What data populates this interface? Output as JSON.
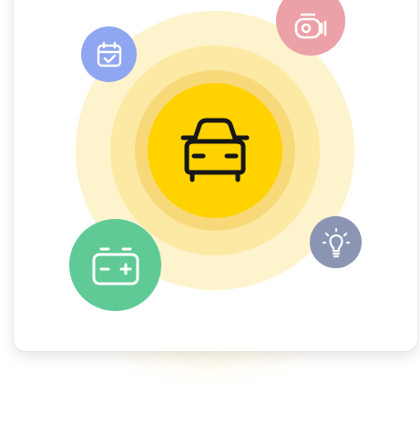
{
  "screen": {
    "name": "car-features-illustration"
  },
  "center": {
    "icon": "car-icon",
    "color": "#ffd200",
    "ring_colors": [
      "#fdf3cc",
      "#fce9a3",
      "#f8d97a"
    ]
  },
  "satellites": [
    {
      "icon": "calendar-check-icon",
      "color": "#8fa7f0"
    },
    {
      "icon": "camera-icon",
      "color": "#eca0a7"
    },
    {
      "icon": "lightbulb-icon",
      "color": "#8c95b4"
    },
    {
      "icon": "battery-icon",
      "color": "#5fca96"
    }
  ]
}
